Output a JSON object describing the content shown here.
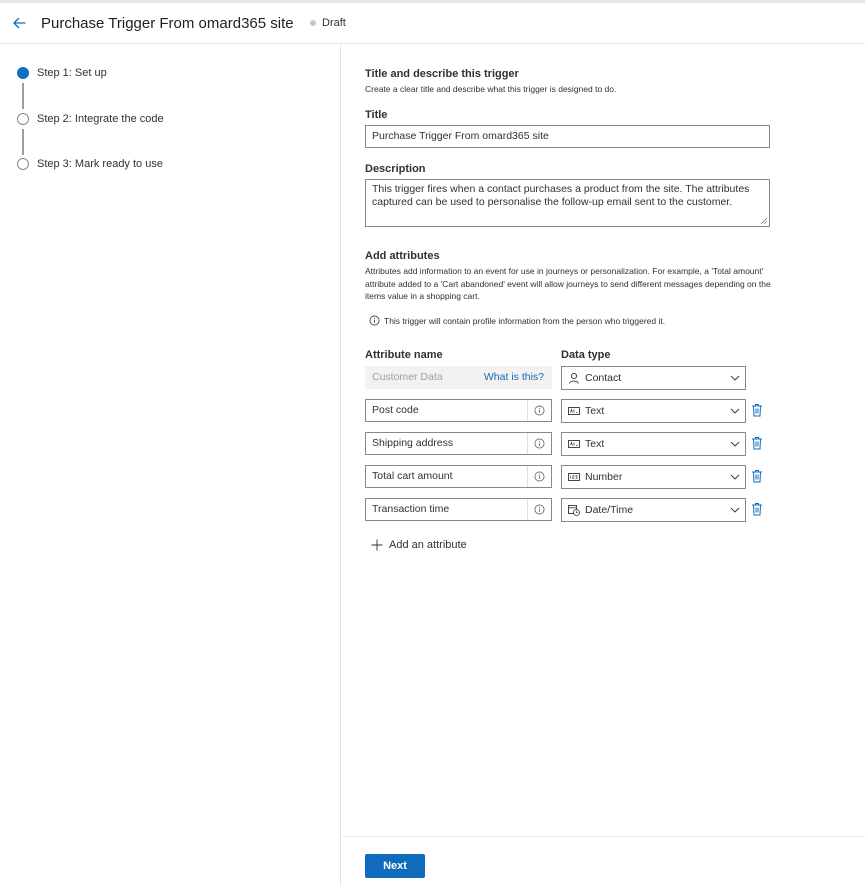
{
  "header": {
    "title": "Purchase Trigger From omard365 site",
    "status": "Draft"
  },
  "steps": [
    {
      "label": "Step 1: Set up",
      "active": true
    },
    {
      "label": "Step 2: Integrate the code",
      "active": false
    },
    {
      "label": "Step 3: Mark ready to use",
      "active": false
    }
  ],
  "form": {
    "section_title": "Title and describe this trigger",
    "section_desc": "Create a clear title and describe what this trigger is designed to do.",
    "title_label": "Title",
    "title_value": "Purchase Trigger From omard365 site",
    "description_label": "Description",
    "description_value": "This trigger fires when a contact purchases a product from the site. The attributes captured can be used to personalise the follow-up email sent to the customer.",
    "attributes_title": "Add attributes",
    "attributes_desc": "Attributes add information to an event for use in journeys or personalization. For example, a 'Total amount' attribute added to a 'Cart abandoned' event will allow journeys to send different messages depending on the items value in a shopping cart.",
    "profile_info": "This trigger will contain profile information from the person who triggered it.",
    "col_attribute_name": "Attribute name",
    "col_data_type": "Data type",
    "customer_data": {
      "name": "Customer Data",
      "link": "What is this?",
      "type": "Contact"
    },
    "attributes": [
      {
        "name": "Post code",
        "type": "Text",
        "icon": "text-field-icon"
      },
      {
        "name": "Shipping address",
        "type": "Text",
        "icon": "text-field-icon"
      },
      {
        "name": "Total cart amount",
        "type": "Number",
        "icon": "number-field-icon"
      },
      {
        "name": "Transaction time",
        "type": "Date/Time",
        "icon": "calendar-clock-icon"
      }
    ],
    "add_attribute": "Add an attribute"
  },
  "footer": {
    "next_label": "Next"
  },
  "colors": {
    "accent": "#0f6cbd",
    "step_active": "#106ebe"
  }
}
